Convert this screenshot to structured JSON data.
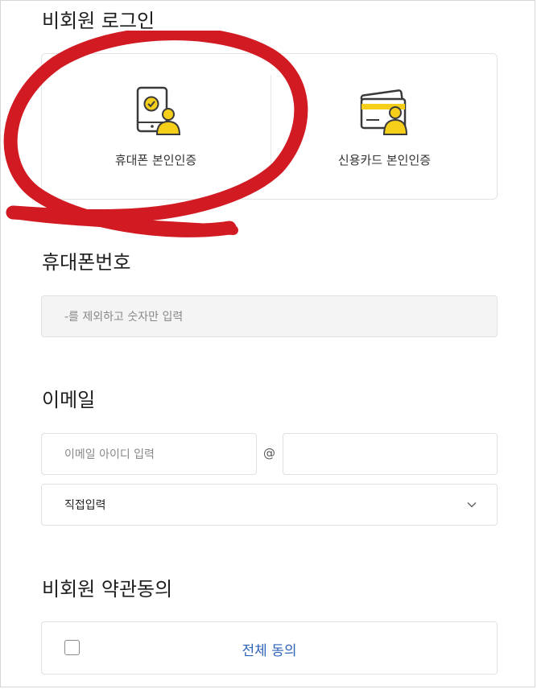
{
  "guest_login": {
    "title": "비회원 로그인",
    "phone_auth_label": "휴대폰 본인인증",
    "card_auth_label": "신용카드 본인인증"
  },
  "phone": {
    "title": "휴대폰번호",
    "placeholder": "-를 제외하고 숫자만 입력"
  },
  "email": {
    "title": "이메일",
    "id_placeholder": "이메일 아이디 입력",
    "at_sign": "@",
    "domain_value": "",
    "domain_select_value": "직접입력"
  },
  "terms": {
    "title": "비회원 약관동의",
    "agree_all_label": "전체 동의"
  },
  "colors": {
    "accent_yellow": "#f6cf1a",
    "annotation_red": "#d11a22",
    "link_blue": "#2f63b8",
    "input_gray_bg": "#f4f4f4"
  },
  "icons": {
    "phone_auth": "phone-person-icon",
    "card_auth": "card-person-icon",
    "dropdown": "chevron-down-icon"
  }
}
